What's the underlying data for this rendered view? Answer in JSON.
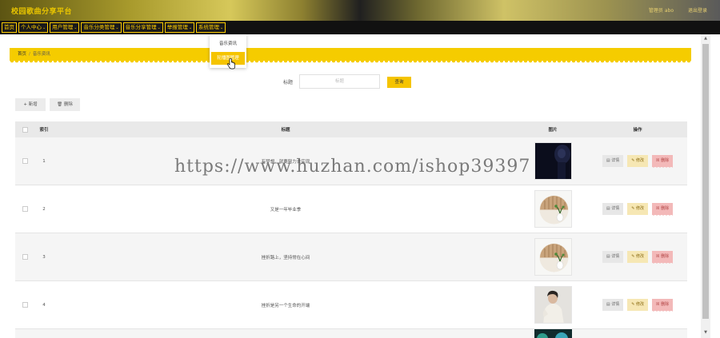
{
  "header": {
    "title": "校园歌曲分享平台",
    "user": "管理员 abo",
    "exit": "退出登录"
  },
  "nav": {
    "items": [
      {
        "label": "首页",
        "has_menu": false
      },
      {
        "label": "个人中心",
        "has_menu": true
      },
      {
        "label": "用户管理",
        "has_menu": true
      },
      {
        "label": "音乐分类管理",
        "has_menu": true
      },
      {
        "label": "音乐分享管理",
        "has_menu": true
      },
      {
        "label": "举报管理",
        "has_menu": true
      },
      {
        "label": "系统管理",
        "has_menu": true
      }
    ],
    "dropdown": [
      "音乐资讯",
      "轮播图管理"
    ]
  },
  "breadcrumb": {
    "home": "首页",
    "separator": "/",
    "current": "音乐资讯"
  },
  "search": {
    "label": "标题",
    "placeholder": "标题",
    "button": "查询"
  },
  "toolbar": {
    "add": "+ 新增",
    "delete": "🗑 删除"
  },
  "table": {
    "headers": {
      "index": "索引",
      "title": "标题",
      "image": "图片",
      "ops": "操作"
    },
    "rows": [
      {
        "index": "1",
        "title": "有梦想，就要努力去实现",
        "image": "dark"
      },
      {
        "index": "2",
        "title": "又是一年毕业季",
        "image": "plant"
      },
      {
        "index": "3",
        "title": "挫折路上，坚持常在心间",
        "image": "plant"
      },
      {
        "index": "4",
        "title": "挫折是另一个生命的开端",
        "image": "portrait"
      }
    ],
    "ops": {
      "detail": "详情",
      "edit": "修改",
      "delete": "删除"
    }
  },
  "watermark": "https://www.huzhan.com/ishop39397",
  "colors": {
    "accent": "#f5c400",
    "nav_bg": "#111111",
    "delete": "#f3b9b9"
  }
}
